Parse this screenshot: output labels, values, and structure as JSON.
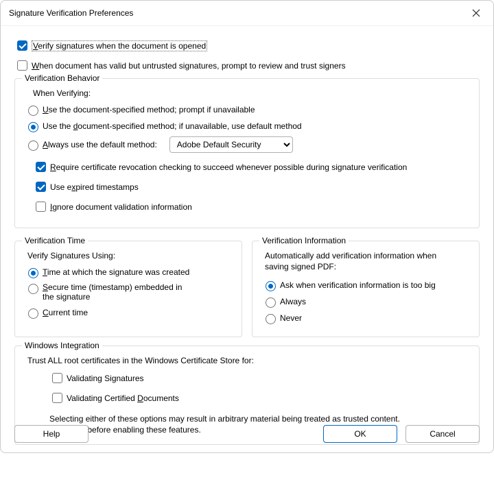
{
  "window": {
    "title": "Signature Verification Preferences"
  },
  "top_checks": {
    "verify_on_open": {
      "label_pre": "V",
      "label_post": "erify signatures when the document is opened",
      "checked": true
    },
    "prompt_untrusted": {
      "label_pre": "W",
      "label_post": "hen document has valid but untrusted signatures, prompt to review and trust signers",
      "checked": false
    }
  },
  "behavior": {
    "legend": "Verification Behavior",
    "subhead": "When Verifying:",
    "methods": {
      "doc_prompt": {
        "pre": "U",
        "post": "se the document-specified method; prompt if unavailable"
      },
      "doc_default": {
        "pre1": "Use the ",
        "mn": "d",
        "post1": "ocument-specified method; if unavailable, use default method"
      },
      "always": {
        "pre": "A",
        "post": "lways use the default method:"
      },
      "selected": "doc_default",
      "select_value": "Adobe Default Security"
    },
    "checks": {
      "require_crl": {
        "pre": "R",
        "post": "equire certificate revocation checking to succeed whenever possible during signature verification",
        "checked": true
      },
      "expired_ts": {
        "pre": "Use e",
        "mn": "x",
        "post": "pired timestamps",
        "checked": true
      },
      "ignore_dvi": {
        "pre": "I",
        "post": "gnore document validation information",
        "checked": false
      }
    }
  },
  "time": {
    "legend": "Verification Time",
    "subhead": "Verify Signatures Using:",
    "opts": {
      "created": {
        "pre": "T",
        "post": "ime at which the signature was created"
      },
      "secure": {
        "pre": "S",
        "post": "ecure time (timestamp) embedded in the signature"
      },
      "current": {
        "pre": "C",
        "post": "urrent time"
      },
      "selected": "created"
    }
  },
  "info": {
    "legend": "Verification Information",
    "subhead": "Automatically add verification information when saving signed PDF:",
    "opts": {
      "ask": {
        "label": "Ask when verification information is too big"
      },
      "always": {
        "label": "Always"
      },
      "never": {
        "label": "Never"
      },
      "selected": "ask"
    }
  },
  "windows": {
    "legend": "Windows Integration",
    "subhead": "Trust ALL root certificates in the Windows Certificate Store for:",
    "sigs": {
      "label": "Validating Signatures",
      "checked": false
    },
    "docs": {
      "pre": "Validating Certified ",
      "mn": "D",
      "post": "ocuments",
      "checked": false
    },
    "note1": "Selecting either of these options may result in arbitrary material being treated as trusted content.",
    "note2": "Take care before enabling these features."
  },
  "buttons": {
    "help": "Help",
    "ok": "OK",
    "cancel": "Cancel"
  }
}
